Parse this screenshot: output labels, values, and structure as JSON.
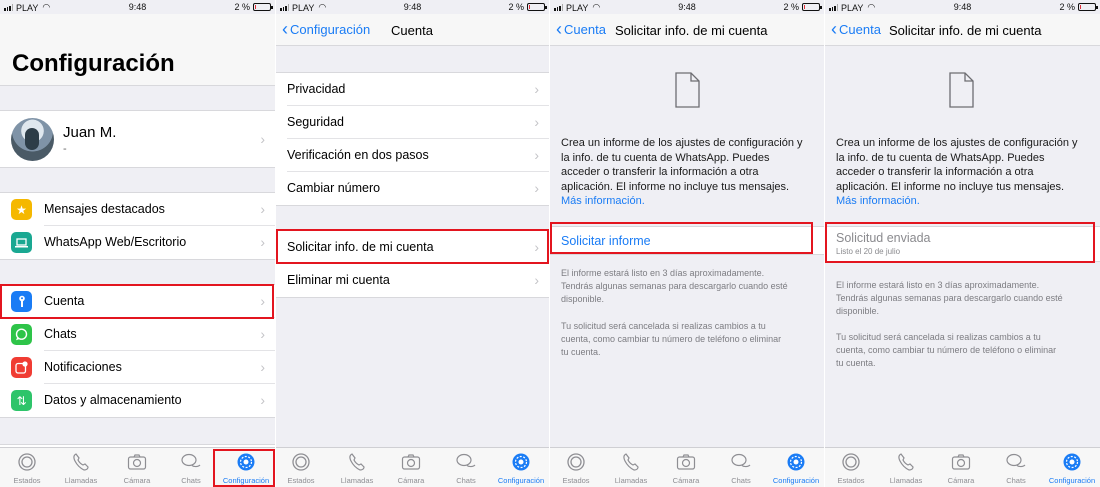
{
  "status": {
    "carrier": "PLAY",
    "time": "9:48",
    "battery": "2 %"
  },
  "panel1": {
    "title": "Configuración",
    "profile": {
      "name": "Juan M.",
      "status": "-"
    },
    "group1": [
      {
        "label": "Mensajes destacados",
        "icon": "star-icon",
        "color": "#f5b800"
      },
      {
        "label": "WhatsApp Web/Escritorio",
        "icon": "laptop-icon",
        "color": "#1aa892"
      }
    ],
    "group2": [
      {
        "label": "Cuenta",
        "icon": "key-icon",
        "color": "#1a7cf5"
      },
      {
        "label": "Chats",
        "icon": "whatsapp-icon",
        "color": "#2ec449"
      },
      {
        "label": "Notificaciones",
        "icon": "notification-icon",
        "color": "#f03c33"
      },
      {
        "label": "Datos y almacenamiento",
        "icon": "data-arrows-icon",
        "color": "#2ec46a"
      }
    ]
  },
  "panel2": {
    "back": "Configuración",
    "title": "Cuenta",
    "group1": [
      "Privacidad",
      "Seguridad",
      "Verificación en dos pasos",
      "Cambiar número"
    ],
    "group2": [
      "Solicitar info. de mi cuenta",
      "Eliminar mi cuenta"
    ]
  },
  "panel3": {
    "back": "Cuenta",
    "title": "Solicitar info. de mi cuenta",
    "info_l1": "Crea un informe de los ajustes de configuración y",
    "info_l2": "la info. de tu cuenta de WhatsApp. Puedes",
    "info_l3": "acceder o transferir la información a otra",
    "info_l4": "aplicación. El informe no incluye tus mensajes.",
    "link": "Más información.",
    "action": "Solicitar informe",
    "foot1_l1": "El informe estará listo en 3 días aproximadamente.",
    "foot1_l2": "Tendrás algunas semanas para descargarlo cuando esté",
    "foot1_l3": "disponible.",
    "foot2_l1": "Tu solicitud será cancelada si realizas cambios a tu",
    "foot2_l2": "cuenta, como cambiar tu número de teléfono o eliminar",
    "foot2_l3": "tu cuenta."
  },
  "panel4": {
    "back": "Cuenta",
    "title": "Solicitar info. de mi cuenta",
    "action": "Solicitud enviada",
    "action_sub": "Listo el 20 de julio"
  },
  "tabs": [
    "Estados",
    "Llamadas",
    "Cámara",
    "Chats",
    "Configuración"
  ],
  "colors": {
    "accent": "#1a7cf5",
    "highlight": "#e3151f"
  }
}
